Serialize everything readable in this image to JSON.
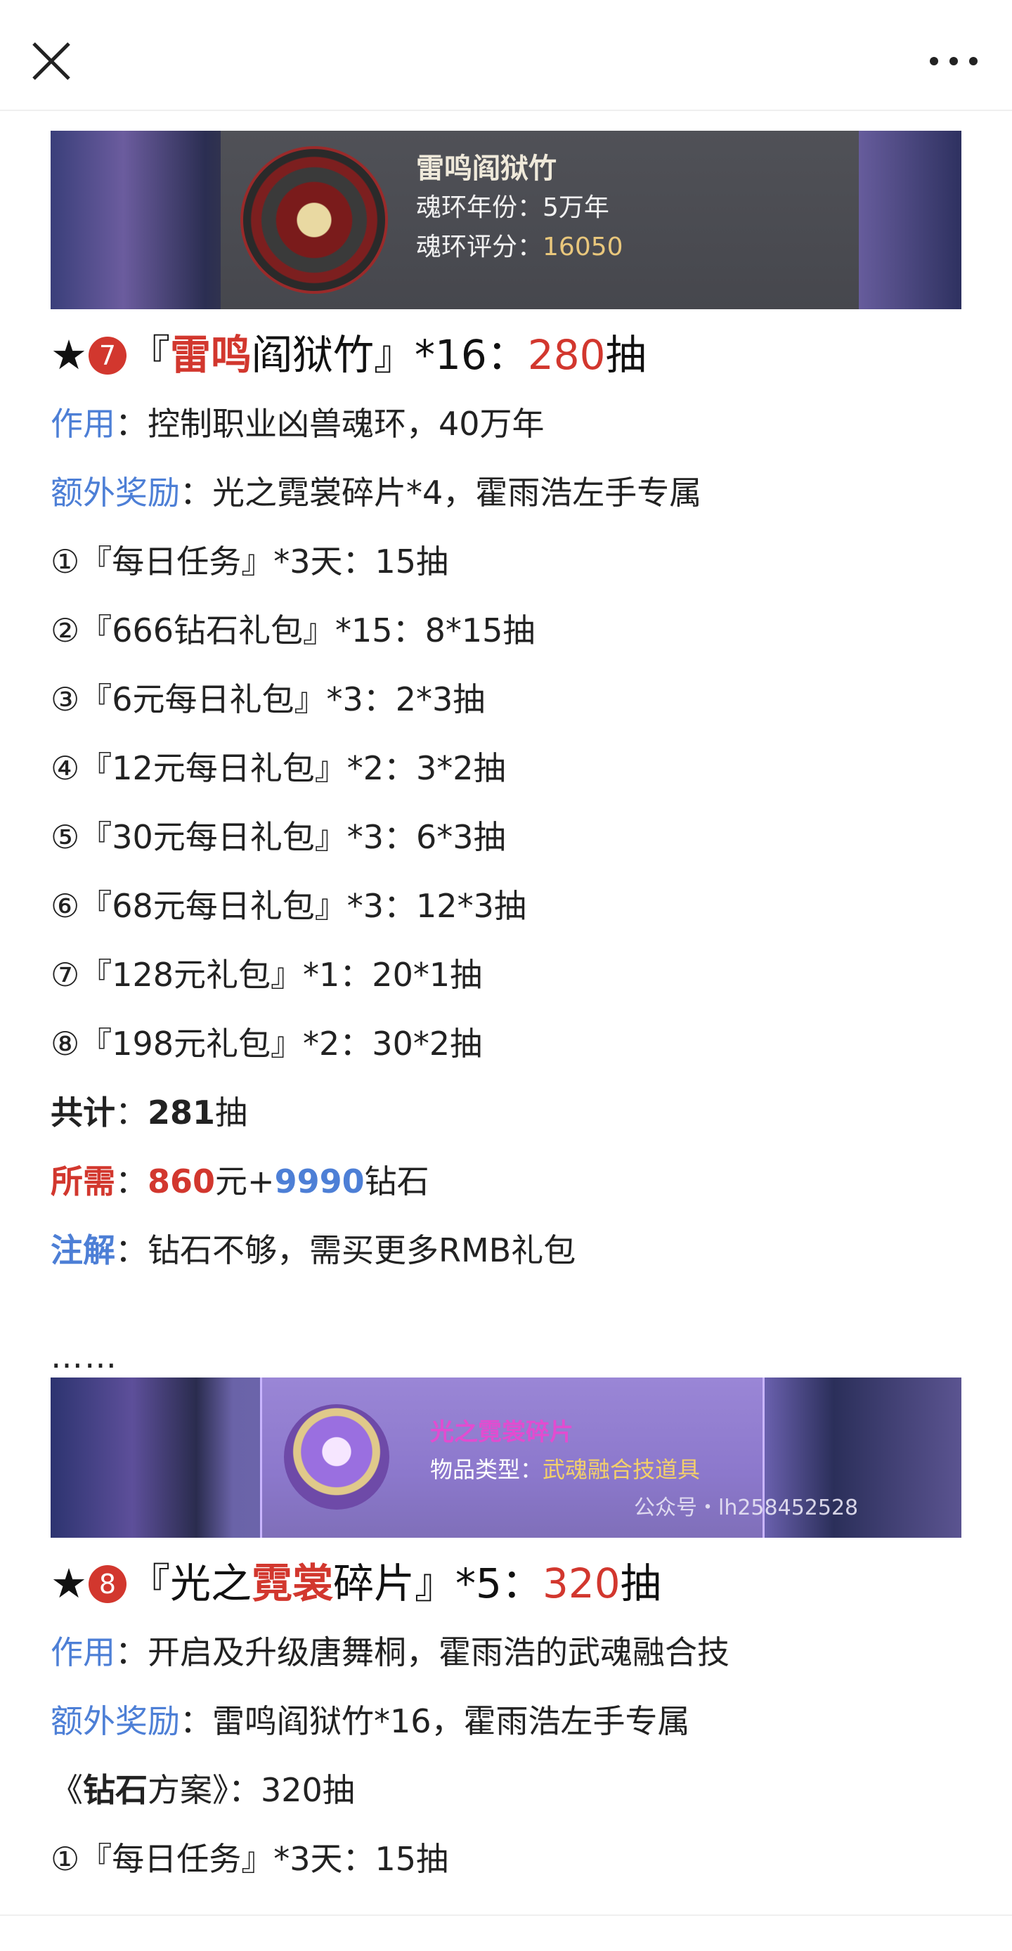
{
  "toolbar": {
    "close_icon": "close-icon",
    "more_icon": "more-icon"
  },
  "banner1": {
    "title": "雷鸣阎狱竹",
    "year_label": "魂环年份：",
    "year_value": "5万年",
    "score_label": "魂环评分：",
    "score_value": "16050"
  },
  "section7": {
    "star": "★",
    "badge": "7",
    "title_prefix": "『",
    "title_red": "雷鸣",
    "title_rest": "阎狱竹』*16：",
    "pulls": "280",
    "pulls_unit": "抽",
    "effect_label": "作用",
    "effect_text": "：控制职业凶兽魂环，40万年",
    "bonus_label": "额外奖励",
    "bonus_text": "：光之霓裳碎片*4，霍雨浩左手专属",
    "items": [
      "①『每日任务』*3天：15抽",
      "②『666钻石礼包』*15：8*15抽",
      "③『6元每日礼包』*3：2*3抽",
      "④『12元每日礼包』*2：3*2抽",
      "⑤『30元每日礼包』*3：6*3抽",
      "⑥『68元每日礼包』*3：12*3抽",
      "⑦『128元礼包』*1：20*1抽",
      "⑧『198元礼包』*2：30*2抽"
    ],
    "total_label": "共计",
    "total_sep": "：",
    "total_value": "281",
    "total_unit": "抽",
    "need_label": "所需",
    "need_sep": "：",
    "need_yuan": "860",
    "need_yuan_unit": "元+",
    "need_diamond": "9990",
    "need_diamond_unit": "钻石",
    "note_label": "注解",
    "note_text": "：钻石不够，需买更多RMB礼包"
  },
  "ellipsis": "……",
  "banner2": {
    "title": "光之霓裳碎片",
    "type_label": "物品类型：",
    "type_value": "武魂融合技道具",
    "watermark": "公众号・lh258452528"
  },
  "section8": {
    "star": "★",
    "badge": "8",
    "title_prefix": "『光之",
    "title_red": "霓裳",
    "title_rest": "碎片』*5：",
    "pulls": "320",
    "pulls_unit": "抽",
    "effect_label": "作用",
    "effect_text": "：开启及升级唐舞桐，霍雨浩的武魂融合技",
    "bonus_label": "额外奖励",
    "bonus_text": "：雷鸣阎狱竹*16，霍雨浩左手专属",
    "plan_open": "《",
    "plan_bold": "钻石",
    "plan_rest": "方案》：320抽",
    "partial_item": "①『每日任务』*3天：15抽"
  }
}
